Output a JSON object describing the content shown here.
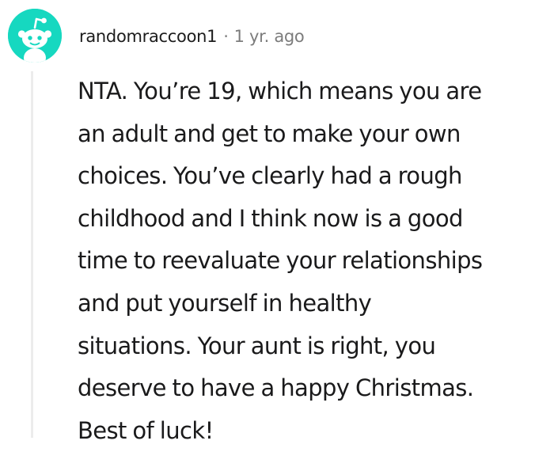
{
  "comment": {
    "author": "randomraccoon1",
    "separator": "·",
    "timestamp": "1 yr. ago",
    "avatar_icon": "reddit-snoo-avatar-icon",
    "avatar_color": "#16d8c0",
    "body": "NTA. You’re 19, which means you are\nan adult and get to make your own\nchoices. You’ve clearly had a rough\nchildhood and I think now is a good\ntime to reevaluate your relationships\nand put yourself in healthy\nsituations. Your aunt is right, you\ndeserve to have a happy Christmas.\nBest of luck!"
  }
}
